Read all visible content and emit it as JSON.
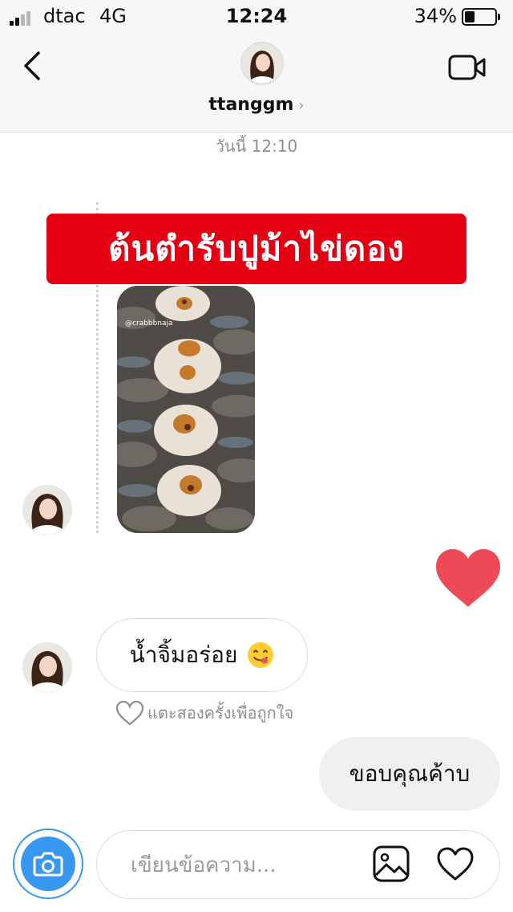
{
  "status_bar": {
    "carrier": "dtac",
    "network": "4G",
    "time": "12:24",
    "battery_percent": "34%",
    "battery_level": 0.34
  },
  "header": {
    "username": "ttanggm",
    "chevron": "›"
  },
  "thread": {
    "timestamp": "วันนี้ 12:10",
    "shared_post": {
      "banner_text": "ต้นตำรับปูม้าไข่ดอง",
      "image_handle": "@crabbbnaja"
    },
    "incoming_message": {
      "text": "น้ำจิ้มอร่อย",
      "emoji": "face-savoring-food"
    },
    "like_hint": "แตะสองครั้งเพื่อถูกใจ",
    "outgoing_message": {
      "text": "ขอบคุณค้าบ"
    }
  },
  "composer": {
    "placeholder": "เขียนข้อความ..."
  },
  "colors": {
    "accent_blue": "#3897f0",
    "heart_red": "#ed4956",
    "banner_red": "#e30012"
  }
}
